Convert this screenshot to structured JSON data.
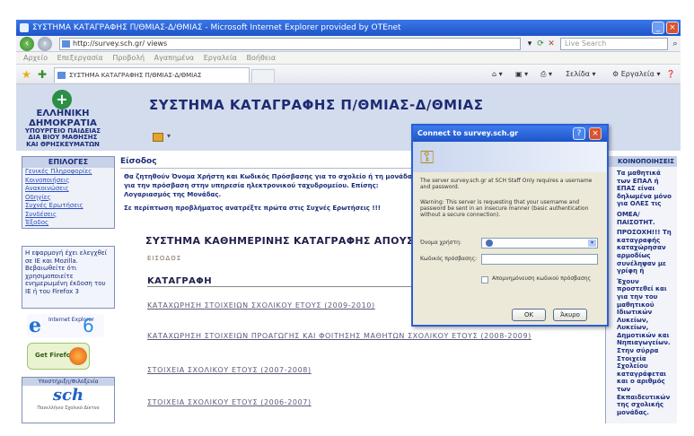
{
  "window": {
    "title": "ΣΥΣΤΗΜΑ ΚΑΤΑΓΡΑΦΗΣ Π/ΘΜΙΑΣ-Δ/ΘΜΙΑΣ - Microsoft Internet Explorer provided by OTEnet",
    "min_glyph": "_",
    "close_glyph": "×"
  },
  "address_bar": {
    "url": "http://survey.sch.gr/ views",
    "search_placeholder": "Live Search"
  },
  "menu": [
    "Αρχείο",
    "Επεξεργασία",
    "Προβολή",
    "Αγαπημένα",
    "Εργαλεία",
    "Βοήθεια"
  ],
  "tab": {
    "label": "ΣΥΣΤΗΜΑ ΚΑΤΑΓΡΑΦΗΣ Π/ΘΜΙΑΣ-Δ/ΘΜΙΑΣ"
  },
  "toolbar_right": {
    "page": "Σελίδα",
    "tools": "Εργαλεία"
  },
  "header": {
    "ministry_line1": "ΕΛΛΗΝΙΚΗ ΔΗΜΟΚΡΑΤΙΑ",
    "ministry_line2": "ΥΠΟΥΡΓΕΙΟ ΠΑΙΔΕΙΑΣ",
    "ministry_line3": "ΔΙΑ ΒΙΟΥ ΜΑΘΗΣΗΣ",
    "ministry_line4": "ΚΑΙ ΘΡΗΣΚΕΥΜΑΤΩΝ",
    "site_title": "ΣΥΣΤΗΜΑ ΚΑΤΑΓΡΑΦΗΣ Π/ΘΜΙΑΣ-Δ/ΘΜΙΑΣ"
  },
  "sidebar": {
    "heading": "ΕΠΙΛΟΓΕΣ",
    "links": [
      "Γενικές Πληροφορίες",
      "Κοινοποιήσεις",
      "Ανακοινώσεις",
      "Οδηγίες",
      "Συχνές Ερωτήσεις",
      "Συνδέσεις",
      "Έξοδος"
    ],
    "note": "Η εφαρμογή έχει ελεγχθεί σε IE και Mozilla. Βεβαιωθείτε ότι χρησιμοποιείτε ενημερωμένη έκδοση του IE ή του Firefox 3",
    "ie_badge_text": "Internet Explorer",
    "ie_version": "6",
    "firefox_text": "Get Firefox",
    "sch_heading": "Υποστήριξη/Φιλοξενία",
    "sch_logo": "sch",
    "sch_sub": "Πανελλήνιο Σχολικό Δίκτυο"
  },
  "main": {
    "section_title": "Είσοδος",
    "intro": "Θα ζητηθούν Όνομα Χρήστη και Κωδικός Πρόσβασης για το σχολείο ή τη μονάδα για την πρόσβαση στην υπηρεσία ηλεκτρονικού ταχυδρομείου. Επίσης: Λογαριασμός της Μονάδας.",
    "hint": "Σε περίπτωση προβλήματος ανατρέξτε πρώτα στις Συχνές Ερωτήσεις !!!",
    "system_title": "ΣΥΣΤΗΜΑ ΚΑΘΗΜΕΡΙΝΗΣ ΚΑΤΑΓΡΑΦΗΣ ΑΠΟΥΣΙΩΝ",
    "entry_link": "ΕΙΣΟΔΟΣ",
    "katagrafi_title": "ΚΑΤΑΓΡΑΦΗ",
    "links": [
      "ΚΑΤΑΧΩΡΗΣΗ ΣΤΟΙΧΕΙΩΝ ΣΧΟΛΙΚΟΥ ΕΤΟΥΣ (2009-2010)",
      "ΚΑΤΑΧΩΡΗΣΗ ΣΤΟΙΧΕΙΩΝ ΠΡΟΑΓΩΓΗΣ ΚΑΙ ΦΟΙΤΗΣΗΣ ΜΑΘΗΤΩΝ ΣΧΟΛΙΚΟΥ ΕΤΟΥΣ (2008-2009)",
      "ΣΤΟΙΧΕΙΑ ΣΧΟΛΙΚΟΥ ΕΤΟΥΣ (2007-2008)",
      "ΣΤΟΙΧΕΙΑ ΣΧΟΛΙΚΟΥ ΕΤΟΥΣ (2006-2007)"
    ]
  },
  "right_panel": {
    "heading": "ΚΟΙΝΟΠΟΙΗΣΕΙΣ",
    "text1": "Τα μαθητικά των ΕΠΑΛ ή ΕΠΑΣ είναι δηλωμένα μόνο για ΟΛΕΣ τις",
    "text2": "ΟΜΕΑ/ΠΑΙΣΟΤΗΤ.",
    "text3": "ΠΡΟΣΟΧΗ!!! Τη καταγραφής καταχώρησαν αρμοδίως συνέληψαν με γρίφη ή",
    "text4": "Έχουν προστεθεί και για την του μαθητικού Ιδιωτικών Λυκείων, Λυκείων, Δημοτικών και Νηπιαγωγείων. Στην σύρρα Στοιχεία Σχολείου καταγράφεται και ο αριθμός των Εκπαιδευτικών της σχολικής μονάδας."
  },
  "dialog": {
    "title": "Connect to survey.sch.gr",
    "help_glyph": "?",
    "close_glyph": "×",
    "text1": "The server survey.sch.gr at SCH Staff Only requires a username and password.",
    "text2": "Warning: This server is requesting that your username and password be sent in an insecure manner (basic authentication without a secure connection).",
    "username_label": "Όνομα χρήστη:",
    "password_label": "Κωδικός πρόσβασης:",
    "remember_label": "Απομνημόνευση κωδικού πρόσβασης",
    "ok_label": "OK",
    "cancel_label": "Άκυρο"
  }
}
